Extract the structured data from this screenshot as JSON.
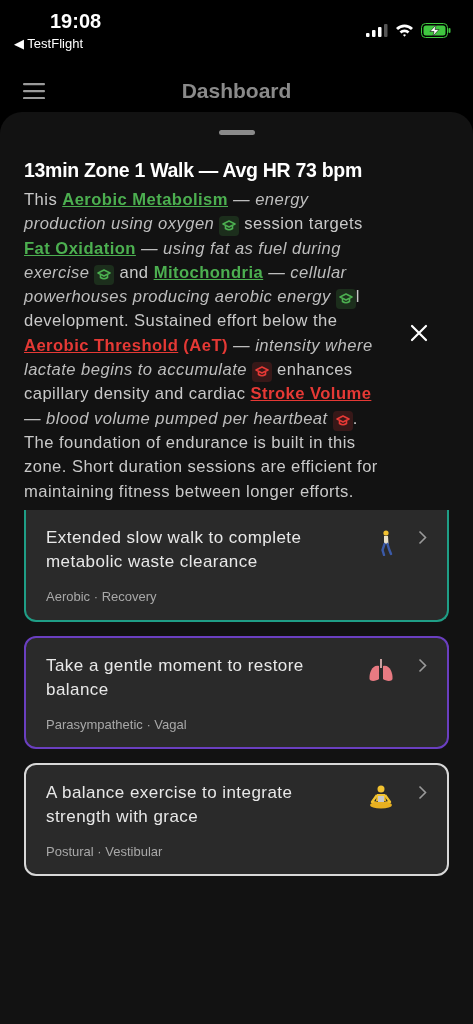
{
  "status_bar": {
    "time": "19:08",
    "back_app": "◀ TestFlight"
  },
  "nav": {
    "title": "Dashboard"
  },
  "detail": {
    "title": "13min Zone 1 Walk — Avg HR 73 bpm",
    "segments": [
      {
        "kind": "text",
        "text": "This "
      },
      {
        "kind": "term",
        "text": "Aerobic Metabolism",
        "color": "#4caf50"
      },
      {
        "kind": "definition",
        "text": " — energy production using oxygen "
      },
      {
        "kind": "cap",
        "color": "#4caf50"
      },
      {
        "kind": "text",
        "text": " session targets "
      },
      {
        "kind": "term",
        "text": "Fat Oxidation",
        "color": "#4caf50"
      },
      {
        "kind": "definition",
        "text": " — using fat as fuel during exercise "
      },
      {
        "kind": "cap",
        "color": "#4caf50"
      },
      {
        "kind": "text",
        "text": " and "
      },
      {
        "kind": "term",
        "text": "Mitochondria",
        "color": "#4caf50"
      },
      {
        "kind": "definition",
        "text": " — cellular powerhouses producing aerobic energy "
      },
      {
        "kind": "cap",
        "color": "#4caf50"
      },
      {
        "kind": "text",
        "text": "l development. Sustained effort below the "
      },
      {
        "kind": "term",
        "text": "Aerobic Threshold",
        "color": "#e53935"
      },
      {
        "kind": "abbr",
        "text": " (AeT)",
        "color": "#e53935"
      },
      {
        "kind": "definition",
        "text": " — intensity where lactate begins to accumulate "
      },
      {
        "kind": "cap",
        "color": "#e53935"
      },
      {
        "kind": "text",
        "text": " enhances capillary density and cardiac "
      },
      {
        "kind": "term",
        "text": "Stroke Volume",
        "color": "#e53935"
      },
      {
        "kind": "definition",
        "text": " — blood volume pumped per heartbeat "
      },
      {
        "kind": "cap",
        "color": "#e53935"
      },
      {
        "kind": "text",
        "text": ". The foundation of endurance is built in this zone. Short duration sessions are efficient for maintaining fitness between longer efforts."
      }
    ]
  },
  "cards": [
    {
      "title": "Extended slow walk to complete metabolic waste clearance",
      "tags": "Aerobic · Recovery",
      "kind": "walk",
      "color": "#1f9e86"
    },
    {
      "title": "Take a gentle moment to restore balance",
      "tags": "Parasympathetic · Vagal",
      "kind": "lungs",
      "color": "#6a3fc0"
    },
    {
      "title": "A balance exercise to integrate strength with grace",
      "tags": "Postural · Vestibular",
      "kind": "meditate",
      "color": "#d8d8d8"
    }
  ]
}
